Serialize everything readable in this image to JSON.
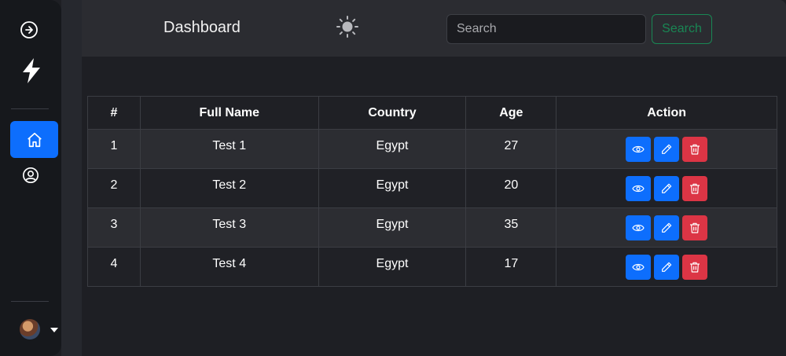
{
  "header": {
    "title": "Dashboard",
    "search": {
      "placeholder": "Search",
      "button_label": "Search"
    }
  },
  "sidebar": {
    "items": [
      {
        "icon": "arrow-right-circle-icon"
      },
      {
        "icon": "lightning-icon"
      },
      {
        "icon": "home-icon",
        "active": true
      },
      {
        "icon": "user-circle-icon"
      }
    ],
    "user": {
      "icon": "avatar"
    }
  },
  "table": {
    "columns": [
      "#",
      "Full Name",
      "Country",
      "Age",
      "Action"
    ],
    "rows": [
      {
        "id": "1",
        "name": "Test 1",
        "country": "Egypt",
        "age": "27"
      },
      {
        "id": "2",
        "name": "Test 2",
        "country": "Egypt",
        "age": "20"
      },
      {
        "id": "3",
        "name": "Test 3",
        "country": "Egypt",
        "age": "35"
      },
      {
        "id": "4",
        "name": "Test 4",
        "country": "Egypt",
        "age": "17"
      }
    ],
    "actions": [
      "eye-icon",
      "pencil-icon",
      "trash-icon"
    ]
  },
  "colors": {
    "primary": "#0d6efd",
    "danger": "#dc3545",
    "success": "#198754",
    "background": "#1e1f24",
    "header": "#2b2c31",
    "sidebar": "#16181c"
  }
}
